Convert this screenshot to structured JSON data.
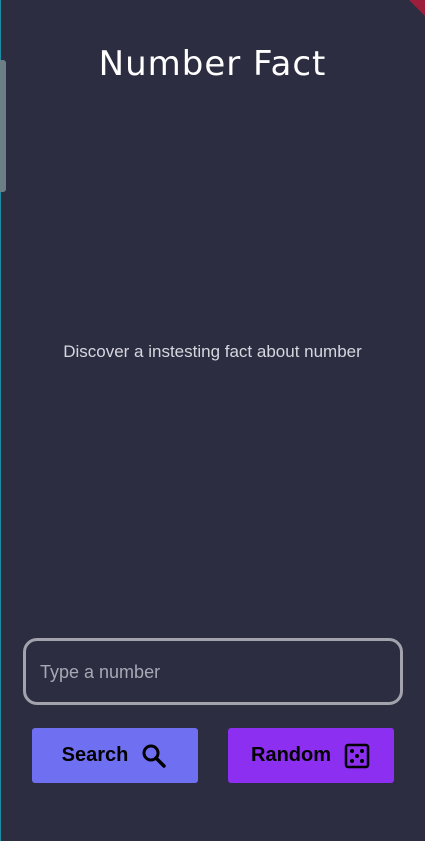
{
  "app": {
    "title": "Number Fact"
  },
  "main": {
    "message": "Discover a instesting fact about number"
  },
  "input": {
    "placeholder": "Type a number",
    "value": ""
  },
  "buttons": {
    "search_label": "Search",
    "search_icon": "search-icon",
    "random_label": "Random",
    "random_icon": "dice-icon"
  },
  "colors": {
    "background": "#2d2d42",
    "search_button": "#6f6ff2",
    "random_button": "#8c2ff0"
  }
}
